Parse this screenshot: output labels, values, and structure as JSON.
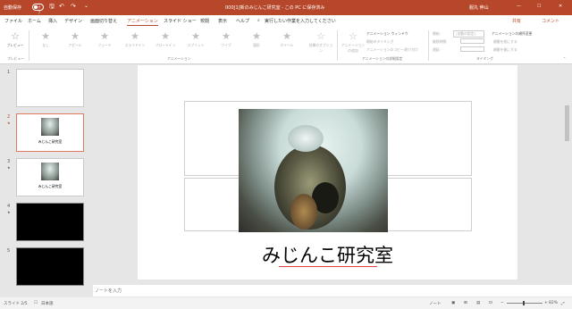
{
  "titlebar": {
    "autosave_label": "自動保存",
    "autosave_state": "オフ",
    "filename": "000[1]新のみじんこ研究室 - この PC に保存済み",
    "user": "服丸 伸山",
    "icons": [
      "save-icon",
      "undo-icon",
      "redo-icon",
      "customize-icon"
    ]
  },
  "menu": {
    "tabs": [
      "ファイル",
      "ホーム",
      "挿入",
      "デザイン",
      "画面切り替え",
      "アニメーション",
      "スライド ショー",
      "校閲",
      "表示",
      "ヘルプ"
    ],
    "active": "アニメーション",
    "search_placeholder": "実行したい作業を入力してください",
    "share_label": "共有",
    "comment_label": "コメント"
  },
  "ribbon": {
    "preview_label": "プレビュー",
    "preview_group": "プレビュー",
    "effects": [
      "なし",
      "アピール",
      "フェード",
      "スライドイン",
      "フロートイン",
      "スプリット",
      "ワイプ",
      "図形",
      "ホイール"
    ],
    "effect_options": "効果のオプション",
    "animation_group": "アニメーション",
    "add_animation": "アニメーションの追加",
    "anim_window": "アニメーション ウィンドウ",
    "trigger": "開始のタイミング",
    "painter": "アニメーションのコピー/貼り付け",
    "advanced_group": "アニメーションの詳細設定",
    "start_label": "開始:",
    "start_value": "(自動の設定)",
    "duration_label": "継続時間:",
    "delay_label": "遅延:",
    "timing_group": "タイミング",
    "reorder_title": "アニメーションの順序変更",
    "move_earlier": "順番を前にする",
    "move_later": "順番を後にする"
  },
  "slides": [
    {
      "num": "1",
      "label": ""
    },
    {
      "num": "2",
      "label": "みじんこ研究室"
    },
    {
      "num": "3",
      "label": "みじんこ研究室"
    },
    {
      "num": "4",
      "label": ""
    },
    {
      "num": "5",
      "label": ""
    }
  ],
  "slide": {
    "title": "みじんこ研究室"
  },
  "notes": {
    "placeholder": "ノートを入力"
  },
  "status": {
    "slide": "スライド 2/5",
    "language": "日本語",
    "notes_btn": "ノート",
    "zoom": "82%"
  }
}
